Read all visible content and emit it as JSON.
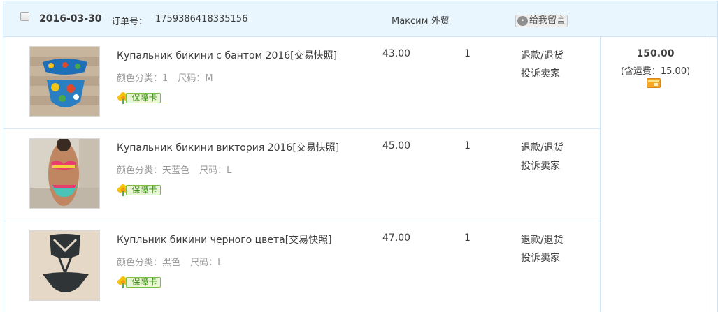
{
  "order": {
    "date": "2016-03-30",
    "order_no_label": "订单号：",
    "order_no": "1759386418335156",
    "shop_name": "Максим 外贸",
    "message_button": "给我留言",
    "total": "150.00",
    "shipping": "(含运费：15.00)",
    "badge_label": "保障卡",
    "items": [
      {
        "title": "Купальник бикини с бантом 2016[交易快照]",
        "color": "颜色分类：1",
        "size": "尺码：M",
        "price": "43.00",
        "qty": "1",
        "refund": "退款/退货",
        "complain": "投诉卖家"
      },
      {
        "title": "Купальник бикини виктория 2016[交易快照]",
        "color": "颜色分类：天蓝色",
        "size": "尺码：L",
        "price": "45.00",
        "qty": "1",
        "refund": "退款/退货",
        "complain": "投诉卖家"
      },
      {
        "title": "Купльник бикини черного цвета[交易快照]",
        "color": "颜色分类：黑色",
        "size": "尺码：L",
        "price": "47.00",
        "qty": "1",
        "refund": "退款/退货",
        "complain": "投诉卖家"
      }
    ]
  },
  "icons": {
    "checkbox": "checkbox-icon",
    "message": "message-bubble-icon",
    "badge": "flower-icon",
    "payment": "credit-card-icon"
  },
  "colors": {
    "header_bg": "#eaf6fd",
    "border": "#cfe3f3",
    "badge_green": "#7cc043",
    "card_orange": "#f5a623"
  }
}
